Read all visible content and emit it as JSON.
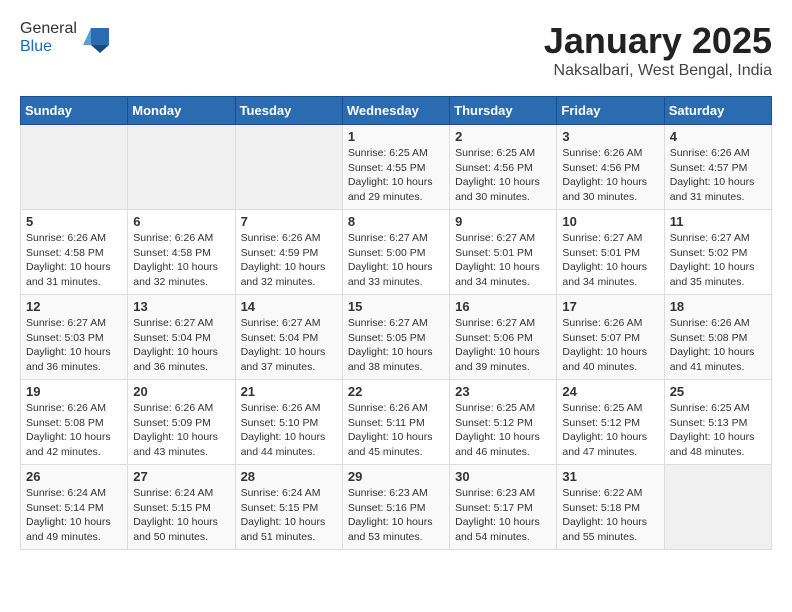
{
  "header": {
    "logo_line1": "General",
    "logo_line2": "Blue",
    "title": "January 2025",
    "subtitle": "Naksalbari, West Bengal, India"
  },
  "weekdays": [
    "Sunday",
    "Monday",
    "Tuesday",
    "Wednesday",
    "Thursday",
    "Friday",
    "Saturday"
  ],
  "weeks": [
    [
      {
        "day": "",
        "sunrise": "",
        "sunset": "",
        "daylight": "",
        "empty": true
      },
      {
        "day": "",
        "sunrise": "",
        "sunset": "",
        "daylight": "",
        "empty": true
      },
      {
        "day": "",
        "sunrise": "",
        "sunset": "",
        "daylight": "",
        "empty": true
      },
      {
        "day": "1",
        "sunrise": "Sunrise: 6:25 AM",
        "sunset": "Sunset: 4:55 PM",
        "daylight": "Daylight: 10 hours and 29 minutes."
      },
      {
        "day": "2",
        "sunrise": "Sunrise: 6:25 AM",
        "sunset": "Sunset: 4:56 PM",
        "daylight": "Daylight: 10 hours and 30 minutes."
      },
      {
        "day": "3",
        "sunrise": "Sunrise: 6:26 AM",
        "sunset": "Sunset: 4:56 PM",
        "daylight": "Daylight: 10 hours and 30 minutes."
      },
      {
        "day": "4",
        "sunrise": "Sunrise: 6:26 AM",
        "sunset": "Sunset: 4:57 PM",
        "daylight": "Daylight: 10 hours and 31 minutes."
      }
    ],
    [
      {
        "day": "5",
        "sunrise": "Sunrise: 6:26 AM",
        "sunset": "Sunset: 4:58 PM",
        "daylight": "Daylight: 10 hours and 31 minutes."
      },
      {
        "day": "6",
        "sunrise": "Sunrise: 6:26 AM",
        "sunset": "Sunset: 4:58 PM",
        "daylight": "Daylight: 10 hours and 32 minutes."
      },
      {
        "day": "7",
        "sunrise": "Sunrise: 6:26 AM",
        "sunset": "Sunset: 4:59 PM",
        "daylight": "Daylight: 10 hours and 32 minutes."
      },
      {
        "day": "8",
        "sunrise": "Sunrise: 6:27 AM",
        "sunset": "Sunset: 5:00 PM",
        "daylight": "Daylight: 10 hours and 33 minutes."
      },
      {
        "day": "9",
        "sunrise": "Sunrise: 6:27 AM",
        "sunset": "Sunset: 5:01 PM",
        "daylight": "Daylight: 10 hours and 34 minutes."
      },
      {
        "day": "10",
        "sunrise": "Sunrise: 6:27 AM",
        "sunset": "Sunset: 5:01 PM",
        "daylight": "Daylight: 10 hours and 34 minutes."
      },
      {
        "day": "11",
        "sunrise": "Sunrise: 6:27 AM",
        "sunset": "Sunset: 5:02 PM",
        "daylight": "Daylight: 10 hours and 35 minutes."
      }
    ],
    [
      {
        "day": "12",
        "sunrise": "Sunrise: 6:27 AM",
        "sunset": "Sunset: 5:03 PM",
        "daylight": "Daylight: 10 hours and 36 minutes."
      },
      {
        "day": "13",
        "sunrise": "Sunrise: 6:27 AM",
        "sunset": "Sunset: 5:04 PM",
        "daylight": "Daylight: 10 hours and 36 minutes."
      },
      {
        "day": "14",
        "sunrise": "Sunrise: 6:27 AM",
        "sunset": "Sunset: 5:04 PM",
        "daylight": "Daylight: 10 hours and 37 minutes."
      },
      {
        "day": "15",
        "sunrise": "Sunrise: 6:27 AM",
        "sunset": "Sunset: 5:05 PM",
        "daylight": "Daylight: 10 hours and 38 minutes."
      },
      {
        "day": "16",
        "sunrise": "Sunrise: 6:27 AM",
        "sunset": "Sunset: 5:06 PM",
        "daylight": "Daylight: 10 hours and 39 minutes."
      },
      {
        "day": "17",
        "sunrise": "Sunrise: 6:26 AM",
        "sunset": "Sunset: 5:07 PM",
        "daylight": "Daylight: 10 hours and 40 minutes."
      },
      {
        "day": "18",
        "sunrise": "Sunrise: 6:26 AM",
        "sunset": "Sunset: 5:08 PM",
        "daylight": "Daylight: 10 hours and 41 minutes."
      }
    ],
    [
      {
        "day": "19",
        "sunrise": "Sunrise: 6:26 AM",
        "sunset": "Sunset: 5:08 PM",
        "daylight": "Daylight: 10 hours and 42 minutes."
      },
      {
        "day": "20",
        "sunrise": "Sunrise: 6:26 AM",
        "sunset": "Sunset: 5:09 PM",
        "daylight": "Daylight: 10 hours and 43 minutes."
      },
      {
        "day": "21",
        "sunrise": "Sunrise: 6:26 AM",
        "sunset": "Sunset: 5:10 PM",
        "daylight": "Daylight: 10 hours and 44 minutes."
      },
      {
        "day": "22",
        "sunrise": "Sunrise: 6:26 AM",
        "sunset": "Sunset: 5:11 PM",
        "daylight": "Daylight: 10 hours and 45 minutes."
      },
      {
        "day": "23",
        "sunrise": "Sunrise: 6:25 AM",
        "sunset": "Sunset: 5:12 PM",
        "daylight": "Daylight: 10 hours and 46 minutes."
      },
      {
        "day": "24",
        "sunrise": "Sunrise: 6:25 AM",
        "sunset": "Sunset: 5:12 PM",
        "daylight": "Daylight: 10 hours and 47 minutes."
      },
      {
        "day": "25",
        "sunrise": "Sunrise: 6:25 AM",
        "sunset": "Sunset: 5:13 PM",
        "daylight": "Daylight: 10 hours and 48 minutes."
      }
    ],
    [
      {
        "day": "26",
        "sunrise": "Sunrise: 6:24 AM",
        "sunset": "Sunset: 5:14 PM",
        "daylight": "Daylight: 10 hours and 49 minutes."
      },
      {
        "day": "27",
        "sunrise": "Sunrise: 6:24 AM",
        "sunset": "Sunset: 5:15 PM",
        "daylight": "Daylight: 10 hours and 50 minutes."
      },
      {
        "day": "28",
        "sunrise": "Sunrise: 6:24 AM",
        "sunset": "Sunset: 5:15 PM",
        "daylight": "Daylight: 10 hours and 51 minutes."
      },
      {
        "day": "29",
        "sunrise": "Sunrise: 6:23 AM",
        "sunset": "Sunset: 5:16 PM",
        "daylight": "Daylight: 10 hours and 53 minutes."
      },
      {
        "day": "30",
        "sunrise": "Sunrise: 6:23 AM",
        "sunset": "Sunset: 5:17 PM",
        "daylight": "Daylight: 10 hours and 54 minutes."
      },
      {
        "day": "31",
        "sunrise": "Sunrise: 6:22 AM",
        "sunset": "Sunset: 5:18 PM",
        "daylight": "Daylight: 10 hours and 55 minutes."
      },
      {
        "day": "",
        "sunrise": "",
        "sunset": "",
        "daylight": "",
        "empty": true
      }
    ]
  ]
}
